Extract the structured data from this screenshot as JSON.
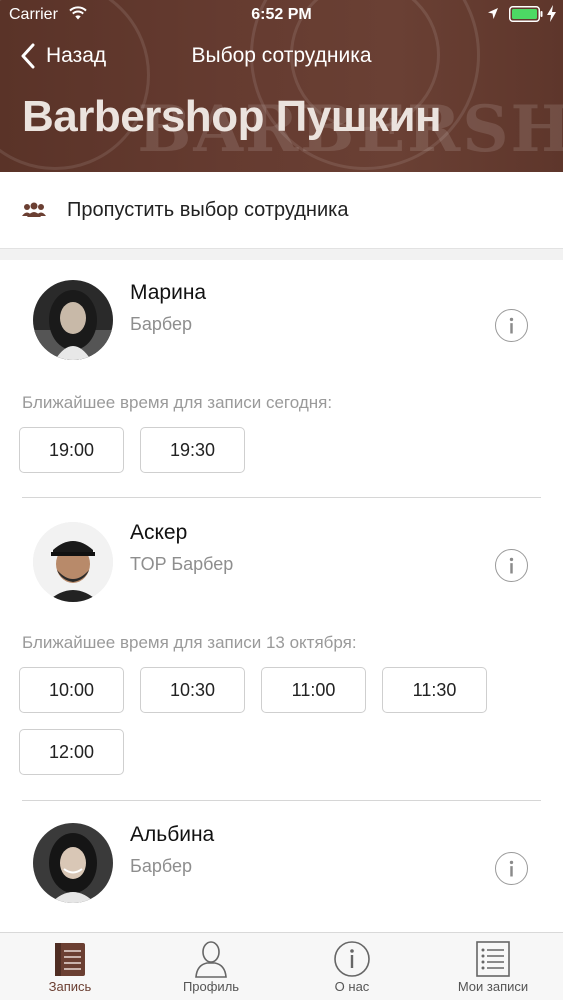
{
  "status_bar": {
    "carrier": "Carrier",
    "time": "6:52 PM"
  },
  "nav": {
    "back_label": "Назад",
    "title": "Выбор сотрудника"
  },
  "header": {
    "title": "Barbershop Пушкин",
    "background_color": "#653b30"
  },
  "skip": {
    "label": "Пропустить выбор сотрудника",
    "icon": "people-icon"
  },
  "employees": [
    {
      "name": "Марина",
      "role": "Барбер",
      "availability": "Ближайшее время для записи сегодня:",
      "slots": [
        "19:00",
        "19:30"
      ]
    },
    {
      "name": "Аскер",
      "role": "TOP Барбер",
      "availability": "Ближайшее время для записи 13 октября:",
      "slots": [
        "10:00",
        "10:30",
        "11:00",
        "11:30",
        "12:00"
      ]
    },
    {
      "name": "Альбина",
      "role": "Барбер",
      "availability": "",
      "slots": []
    }
  ],
  "tabbar": {
    "active_color": "#6b3f32",
    "tabs": [
      {
        "label": "Запись",
        "icon": "booking-icon",
        "active": true
      },
      {
        "label": "Профиль",
        "icon": "profile-icon",
        "active": false
      },
      {
        "label": "О нас",
        "icon": "info-icon",
        "active": false
      },
      {
        "label": "Мои записи",
        "icon": "list-icon",
        "active": false
      }
    ]
  }
}
